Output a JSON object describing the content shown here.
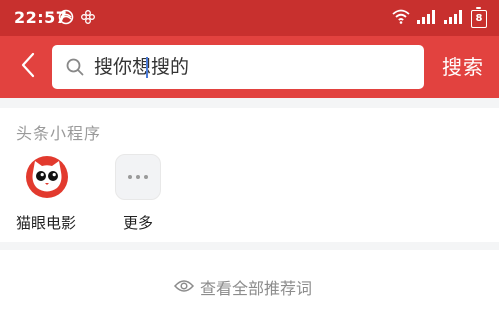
{
  "status_bar": {
    "time": "22:57",
    "battery_level": "8",
    "icons": [
      "sync-icon",
      "flower-icon",
      "wifi-icon",
      "signal-icon",
      "signal-icon",
      "battery-icon"
    ]
  },
  "nav": {
    "back_icon": "chevron-left-icon",
    "search_placeholder": "搜你想搜的",
    "search_button_label": "搜索"
  },
  "mini_programs": {
    "title": "头条小程序",
    "items": [
      {
        "label": "猫眼电影",
        "icon": "cat-eye-icon"
      },
      {
        "label": "更多",
        "icon": "more-icon"
      }
    ]
  },
  "recommend": {
    "label": "查看全部推荐词",
    "icon": "eye-icon"
  },
  "colors": {
    "status_bar_bg": "#c8302e",
    "nav_bg": "#e2423f",
    "page_bg": "#f4f5f6"
  }
}
